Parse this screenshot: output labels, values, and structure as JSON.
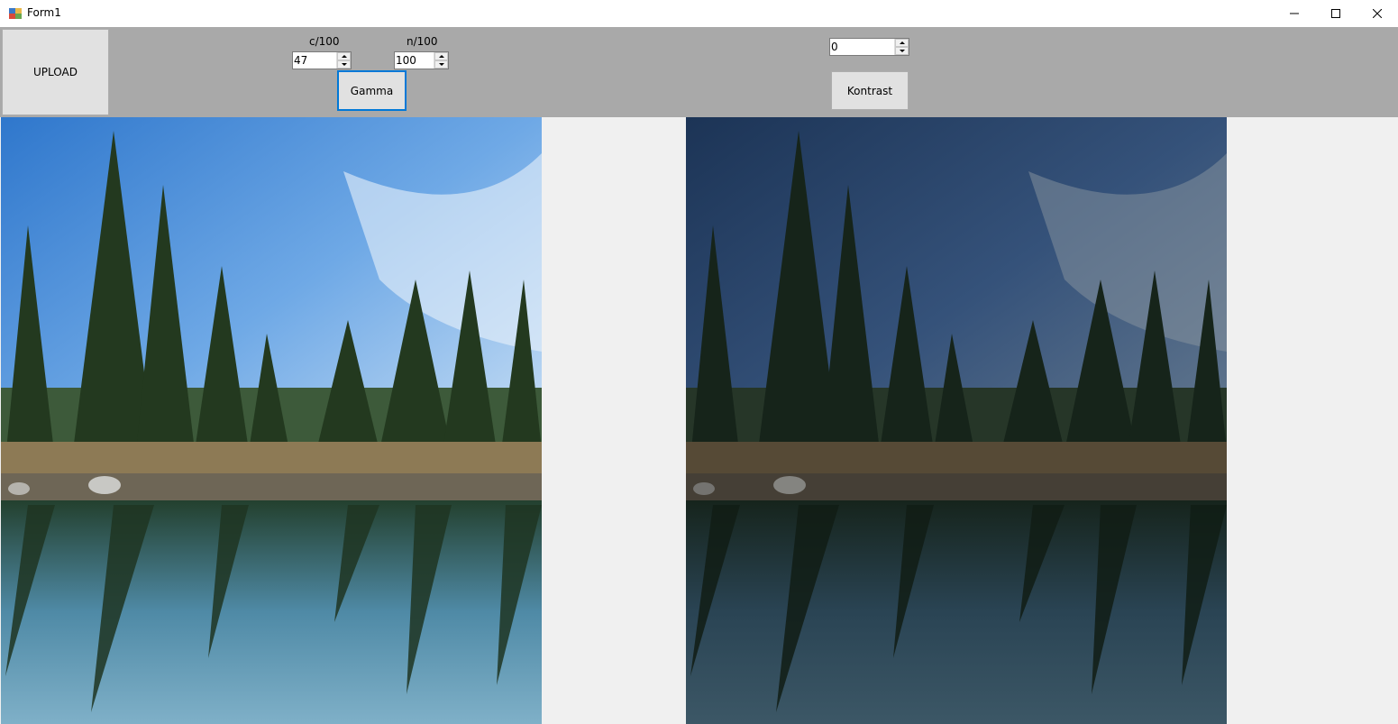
{
  "window": {
    "title": "Form1"
  },
  "toolbar": {
    "upload_label": "UPLOAD",
    "c_label": "c/100",
    "c_value": "47",
    "n_label": "n/100",
    "n_value": "100",
    "gamma_label": "Gamma",
    "contrast_value": "0",
    "contrast_label": "Kontrast"
  },
  "images": {
    "original": {
      "icon": "landscape-photo",
      "description_colors": {
        "sky": "#4a8fd8",
        "trees": "#2f4a2c",
        "water": "#3e6d86"
      }
    },
    "processed": {
      "icon": "landscape-photo",
      "description_colors": {
        "sky": "#2d4a6e",
        "trees": "#1f2f27",
        "water": "#22343f"
      }
    }
  },
  "colors": {
    "toolbar": "#a9a9a9",
    "accent": "#0078d7",
    "panel": "#f0f0f0"
  }
}
